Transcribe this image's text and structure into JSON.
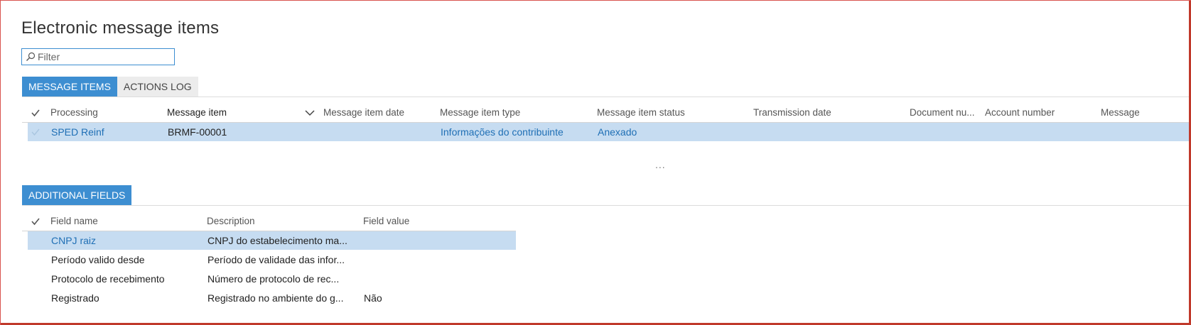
{
  "page": {
    "title": "Electronic message items"
  },
  "filter": {
    "placeholder": "Filter"
  },
  "top_tabs": [
    {
      "label": "MESSAGE ITEMS",
      "active": true
    },
    {
      "label": "ACTIONS LOG",
      "active": false
    }
  ],
  "items_grid": {
    "columns": [
      "Processing",
      "Message item",
      "Message item date",
      "Message item type",
      "Message item status",
      "Transmission date",
      "Document nu...",
      "Account number",
      "Message"
    ],
    "rows": [
      {
        "processing": "SPED Reinf",
        "message_item": "BRMF-00001",
        "message_item_date": "",
        "message_item_type": "Informações do contribuinte",
        "message_item_status": "Anexado",
        "transmission_date": "",
        "document_number": "",
        "account_number": "",
        "message": ""
      }
    ]
  },
  "ellipsis": "...",
  "additional_tabs": [
    {
      "label": "ADDITIONAL FIELDS",
      "active": true
    }
  ],
  "fields_grid": {
    "columns": [
      "Field name",
      "Description",
      "Field value"
    ],
    "rows": [
      {
        "field_name": "CNPJ raiz",
        "description": "CNPJ do estabelecimento ma...",
        "field_value": ""
      },
      {
        "field_name": "Período valido desde",
        "description": "Período de validade das infor...",
        "field_value": ""
      },
      {
        "field_name": "Protocolo de recebimento",
        "description": "Número de protocolo de rec...",
        "field_value": ""
      },
      {
        "field_name": "Registrado",
        "description": "Registrado no ambiente do g...",
        "field_value": "Não"
      }
    ]
  },
  "colors": {
    "accent": "#3d8ed1",
    "selection": "#c6dcf1",
    "link": "#1f6fb5",
    "frame": "#c0392b"
  }
}
